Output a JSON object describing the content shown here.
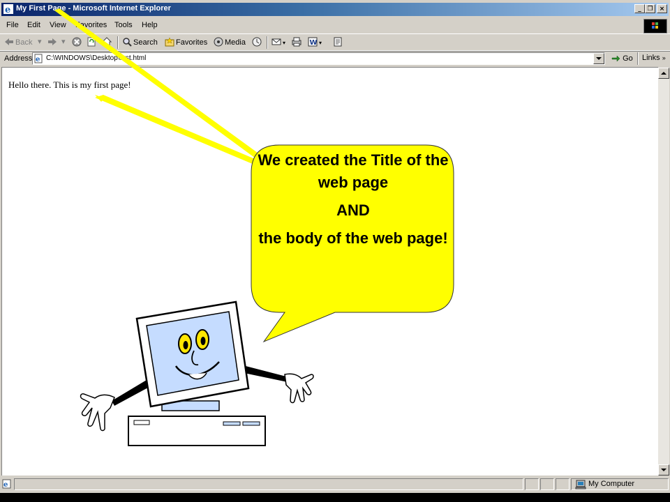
{
  "window": {
    "title": "My First Page - Microsoft Internet Explorer",
    "caption_buttons": [
      "_",
      "❐",
      "×"
    ]
  },
  "menu": [
    "File",
    "Edit",
    "View",
    "Favorites",
    "Tools",
    "Help"
  ],
  "toolbar": {
    "back": "Back",
    "search": "Search",
    "favorites": "Favorites",
    "media": "Media"
  },
  "address": {
    "label": "Address",
    "value": "C:\\WINDOWS\\Desktop\\first.html",
    "go": "Go",
    "links": "Links"
  },
  "page": {
    "body_text": "Hello there. This is my first page!"
  },
  "status": {
    "zone": "My Computer"
  },
  "callout": {
    "line1": "We created the Title of the web page",
    "line2": "AND",
    "line3": "the body of the web page!",
    "fill_color": "#ffff00"
  },
  "illustration": {
    "name": "computer-mascot",
    "screen_color": "#c5dcff"
  }
}
